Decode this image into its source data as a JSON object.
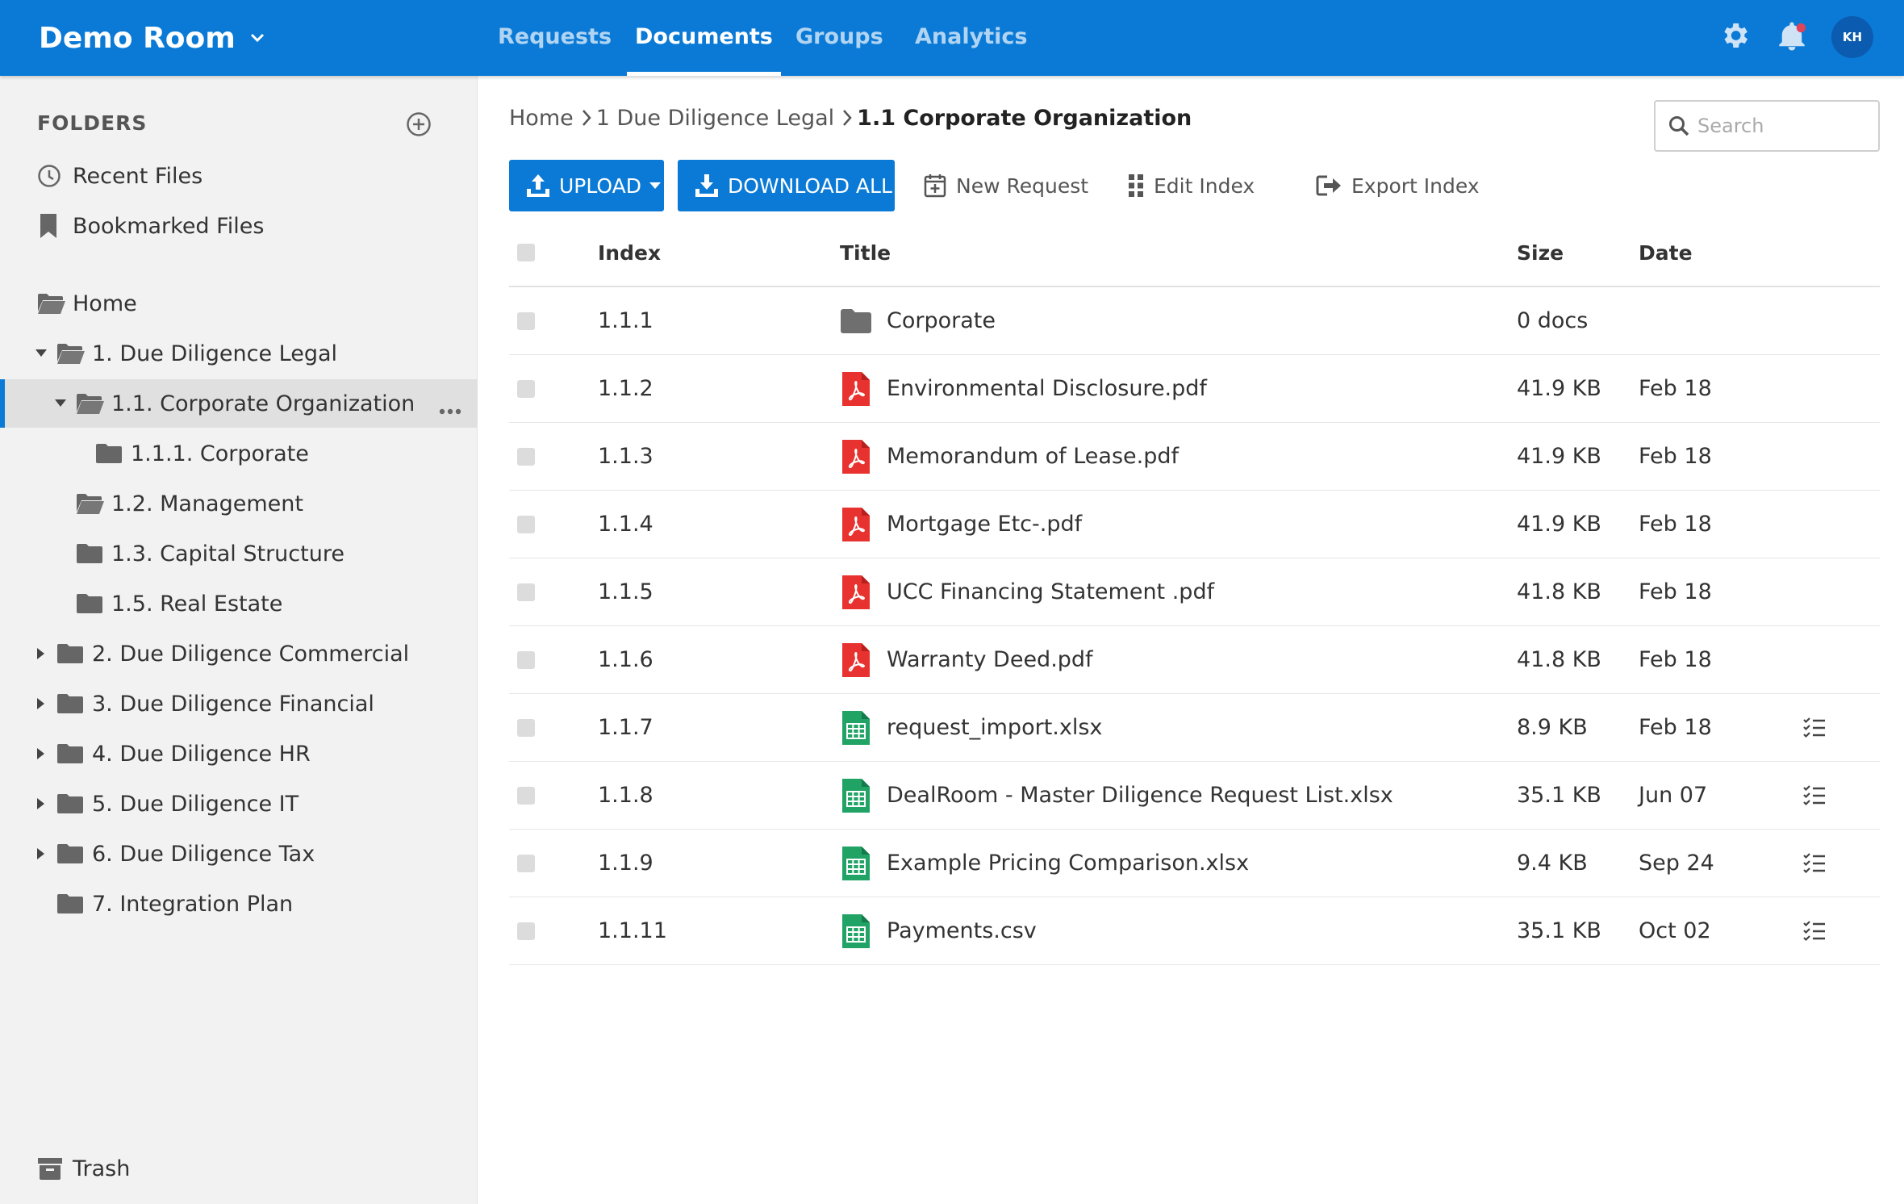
{
  "header": {
    "room_name": "Demo Room",
    "tabs": [
      {
        "label": "Requests",
        "active": false
      },
      {
        "label": "Documents",
        "active": true
      },
      {
        "label": "Groups",
        "active": false
      },
      {
        "label": "Analytics",
        "active": false
      }
    ],
    "avatar_initials": "KH",
    "notification_dot_color": "#e0445b"
  },
  "sidebar": {
    "title": "FOLDERS",
    "quick": [
      {
        "label": "Recent Files",
        "icon": "clock-icon"
      },
      {
        "label": "Bookmarked Files",
        "icon": "bookmark-icon"
      }
    ],
    "tree": [
      {
        "label": "Home",
        "icon": "folder-open-icon"
      },
      {
        "label": "1. Due Diligence Legal",
        "icon": "folder-open-icon",
        "expanded": true
      },
      {
        "label": "1.1. Corporate Organization",
        "icon": "folder-open-icon",
        "expanded": true,
        "selected": true
      },
      {
        "label": "1.1.1. Corporate",
        "icon": "folder-icon"
      },
      {
        "label": "1.2. Management",
        "icon": "folder-open-icon"
      },
      {
        "label": "1.3. Capital Structure",
        "icon": "folder-icon"
      },
      {
        "label": "1.5. Real Estate",
        "icon": "folder-icon"
      },
      {
        "label": "2. Due Diligence Commercial",
        "icon": "folder-icon",
        "expanded": false
      },
      {
        "label": "3. Due Diligence Financial",
        "icon": "folder-icon",
        "expanded": false
      },
      {
        "label": "4. Due Diligence HR",
        "icon": "folder-icon",
        "expanded": false
      },
      {
        "label": "5. Due Diligence IT",
        "icon": "folder-icon",
        "expanded": false
      },
      {
        "label": "6. Due Diligence Tax",
        "icon": "folder-icon",
        "expanded": false
      },
      {
        "label": "7. Integration Plan",
        "icon": "folder-icon"
      }
    ],
    "trash_label": "Trash"
  },
  "main": {
    "breadcrumb": [
      "Home",
      "1 Due Diligence Legal",
      "1.1 Corporate Organization"
    ],
    "search_placeholder": "Search",
    "toolbar": {
      "upload": "UPLOAD",
      "download_all": "DOWNLOAD ALL",
      "new_request": "New Request",
      "edit_index": "Edit Index",
      "export_index": "Export Index"
    },
    "columns": {
      "index": "Index",
      "title": "Title",
      "size": "Size",
      "date": "Date"
    },
    "rows": [
      {
        "index": "1.1.1",
        "title": "Corporate",
        "type": "folder",
        "size": "0 docs",
        "date": "",
        "has_requests": false
      },
      {
        "index": "1.1.2",
        "title": "Environmental Disclosure.pdf",
        "type": "pdf",
        "size": "41.9 KB",
        "date": "Feb 18",
        "has_requests": false
      },
      {
        "index": "1.1.3",
        "title": "Memorandum of Lease.pdf",
        "type": "pdf",
        "size": "41.9 KB",
        "date": "Feb 18",
        "has_requests": false
      },
      {
        "index": "1.1.4",
        "title": "Mortgage Etc-.pdf",
        "type": "pdf",
        "size": "41.9 KB",
        "date": "Feb 18",
        "has_requests": false
      },
      {
        "index": "1.1.5",
        "title": "UCC Financing Statement .pdf",
        "type": "pdf",
        "size": "41.8 KB",
        "date": "Feb 18",
        "has_requests": false
      },
      {
        "index": "1.1.6",
        "title": "Warranty Deed.pdf",
        "type": "pdf",
        "size": "41.8 KB",
        "date": "Feb 18",
        "has_requests": false
      },
      {
        "index": "1.1.7",
        "title": "request_import.xlsx",
        "type": "sheet",
        "size": "8.9 KB",
        "date": "Feb 18",
        "has_requests": true
      },
      {
        "index": "1.1.8",
        "title": "DealRoom - Master Diligence Request List.xlsx",
        "type": "sheet",
        "size": "35.1 KB",
        "date": "Jun 07",
        "has_requests": true
      },
      {
        "index": "1.1.9",
        "title": "Example Pricing Comparison.xlsx",
        "type": "sheet",
        "size": "9.4 KB",
        "date": "Sep 24",
        "has_requests": true
      },
      {
        "index": "1.1.11",
        "title": "Payments.csv",
        "type": "sheet",
        "size": "35.1 KB",
        "date": "Oct 02",
        "has_requests": true
      }
    ]
  },
  "colors": {
    "brand_blue": "#0a7ad6",
    "pdf_red": "#e8322f",
    "sheet_green": "#21a366",
    "folder_gray": "#6f6f6f"
  }
}
